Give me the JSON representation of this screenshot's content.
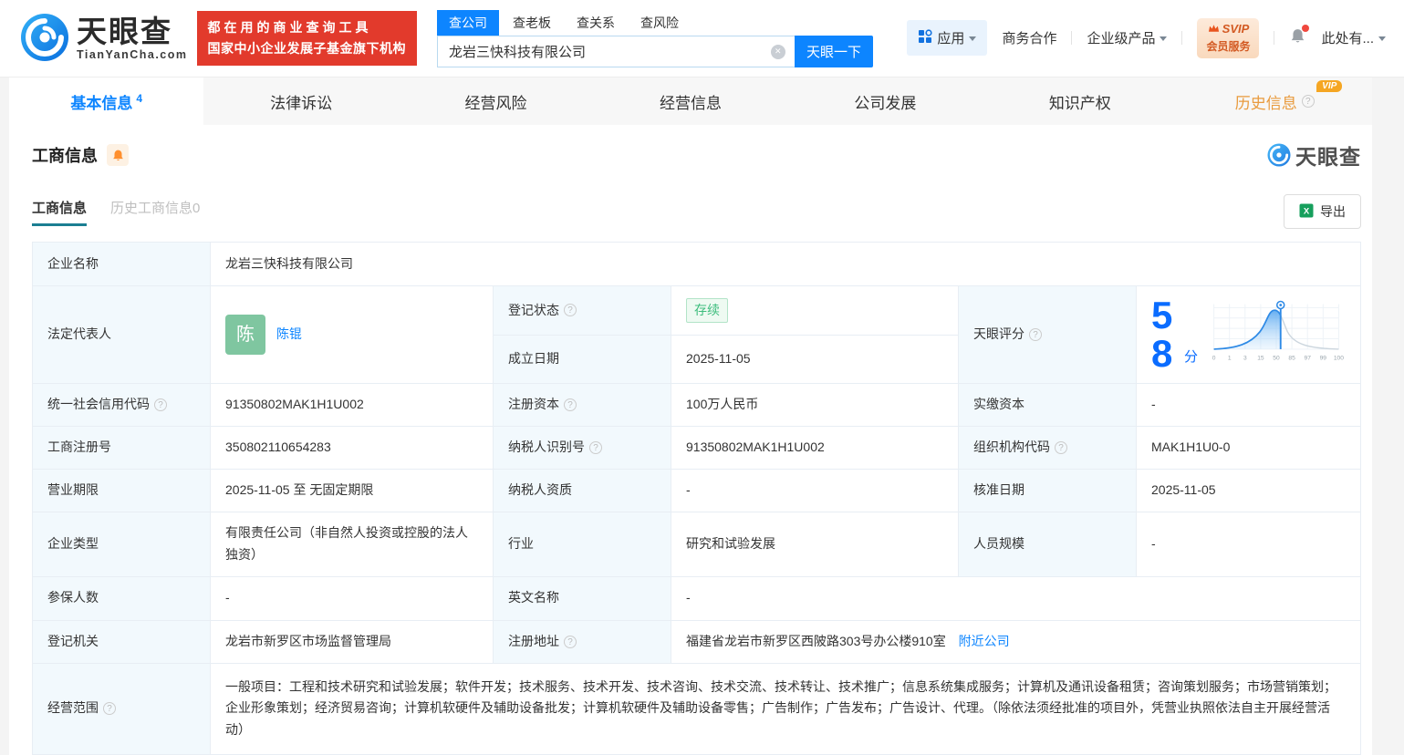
{
  "brand": {
    "name": "天眼查",
    "domain": "TianYanCha.com",
    "slogan_line1": "都在用的商业查询工具",
    "slogan_line2": "国家中小企业发展子基金旗下机构"
  },
  "search": {
    "tabs": [
      "查公司",
      "查老板",
      "查关系",
      "查风险"
    ],
    "active_tab": "查公司",
    "value": "龙岩三快科技有限公司",
    "button": "天眼一下"
  },
  "top_menu": {
    "apps": "应用",
    "business_coop": "商务合作",
    "enterprise_products": "企业级产品",
    "svip_line1": "SVIP",
    "svip_line2": "会员服务",
    "user_more": "此处有..."
  },
  "nav": {
    "items": [
      {
        "label": "基本信息",
        "count": "4"
      },
      {
        "label": "法律诉讼"
      },
      {
        "label": "经营风险"
      },
      {
        "label": "经营信息"
      },
      {
        "label": "公司发展"
      },
      {
        "label": "知识产权"
      },
      {
        "label": "历史信息",
        "vip": "VIP"
      }
    ]
  },
  "section": {
    "title": "工商信息",
    "watermark": "天眼查",
    "subtab_active": "工商信息",
    "subtab_history": "历史工商信息0",
    "export_label": "导出"
  },
  "fields": {
    "company_name": {
      "label": "企业名称",
      "value": "龙岩三快科技有限公司"
    },
    "legal_rep": {
      "label": "法定代表人",
      "value": "陈锟",
      "avatar": "陈"
    },
    "reg_status": {
      "label": "登记状态",
      "value": "存续"
    },
    "establish_date": {
      "label": "成立日期",
      "value": "2025-11-05"
    },
    "score": {
      "label": "天眼评分"
    },
    "credit_code": {
      "label": "统一社会信用代码",
      "value": "91350802MAK1H1U002"
    },
    "reg_capital": {
      "label": "注册资本",
      "value": "100万人民币"
    },
    "paid_capital": {
      "label": "实缴资本",
      "value": "-"
    },
    "reg_number": {
      "label": "工商注册号",
      "value": "350802110654283"
    },
    "taxpayer_id": {
      "label": "纳税人识别号",
      "value": "91350802MAK1H1U002"
    },
    "org_code": {
      "label": "组织机构代码",
      "value": "MAK1H1U0-0"
    },
    "business_term": {
      "label": "营业期限",
      "value": "2025-11-05 至 无固定期限"
    },
    "taxpayer_quality": {
      "label": "纳税人资质",
      "value": "-"
    },
    "approval_date": {
      "label": "核准日期",
      "value": "2025-11-05"
    },
    "company_type": {
      "label": "企业类型",
      "value": "有限责任公司（非自然人投资或控股的法人独资）"
    },
    "industry": {
      "label": "行业",
      "value": "研究和试验发展"
    },
    "staff_size": {
      "label": "人员规模",
      "value": "-"
    },
    "insured_count": {
      "label": "参保人数",
      "value": "-"
    },
    "english_name": {
      "label": "英文名称",
      "value": "-"
    },
    "reg_authority": {
      "label": "登记机关",
      "value": "龙岩市新罗区市场监督管理局"
    },
    "reg_address": {
      "label": "注册地址",
      "value": "福建省龙岩市新罗区西陂路303号办公楼910室",
      "nearby_link": "附近公司"
    },
    "business_scope": {
      "label": "经营范围",
      "value": "一般项目：工程和技术研究和试验发展；软件开发；技术服务、技术开发、技术咨询、技术交流、技术转让、技术推广；信息系统集成服务；计算机及通讯设备租赁；咨询策划服务；市场营销策划；企业形象策划；经济贸易咨询；计算机软硬件及辅助设备批发；计算机软硬件及辅助设备零售；广告制作；广告发布；广告设计、代理。（除依法须经批准的项目外，凭营业执照依法自主开展经营活动）"
    }
  },
  "chart_data": {
    "type": "area",
    "title": "天眼评分",
    "score": 58,
    "score_unit": "分",
    "x_ticks": [
      "0",
      "1",
      "3",
      "15",
      "50",
      "85",
      "97",
      "99",
      "100"
    ],
    "xlim": [
      0,
      100
    ],
    "marker_value": 58,
    "curve": "normal-distribution bell curve; area left of score marker filled blue, right side gray",
    "grid": true,
    "accent_color": "#2e8ae6"
  },
  "icons": {
    "brand_logo": "tianyancha-swirl-icon",
    "apps": "grid-icon",
    "clear": "circle-x-icon",
    "crown": "crown-icon",
    "notification": "bell-icon",
    "section_subscribe": "bell-icon",
    "help": "question-circle-icon",
    "export": "excel-icon",
    "score_marker": "pin-marker-icon",
    "dropdown": "chevron-down-icon"
  },
  "colors": {
    "brand_blue": "#0d85ff",
    "banner_red": "#e23a2c",
    "vip_orange": "#f5a623",
    "status_green": "#3dbd7d",
    "score_blue": "#0a6cff",
    "subtab_underline": "#1b7e92",
    "label_cell_bg": "#f2f9fd",
    "border": "#e8eef4"
  }
}
